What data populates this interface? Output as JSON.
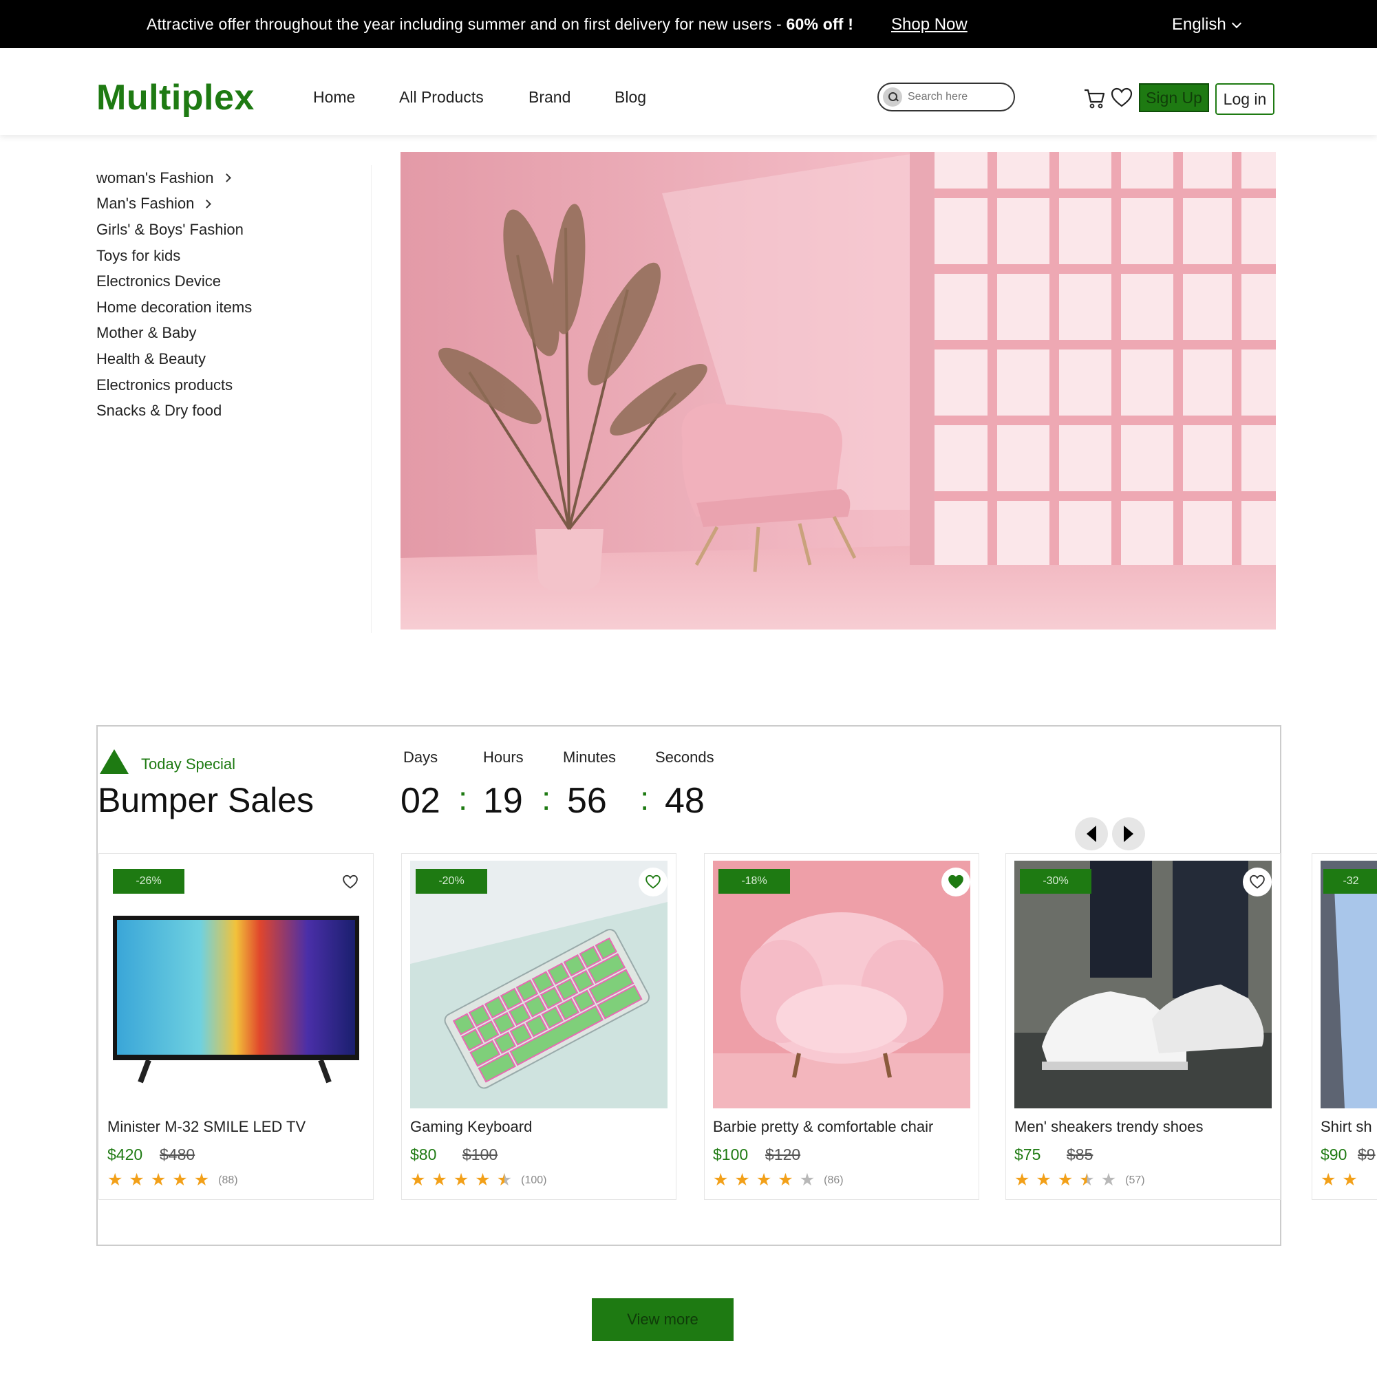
{
  "topbar": {
    "promo_text": "Attractive offer throughout the year including summer and on first delivery for new users - ",
    "promo_bold": "60% off !",
    "shop_now": "Shop Now",
    "language": "English"
  },
  "header": {
    "logo": "Multiplex",
    "nav": [
      "Home",
      "All Products",
      "Brand",
      "Blog"
    ],
    "search_placeholder": "Search here",
    "signup": "Sign Up",
    "login": "Log in"
  },
  "sidebar": {
    "categories": [
      {
        "label": "woman's Fashion"
      },
      {
        "label": "Man's Fashion"
      },
      {
        "label": "Girls' & Boys' Fashion"
      },
      {
        "label": "Toys for kids"
      },
      {
        "label": "Electronics Device"
      },
      {
        "label": "Home decoration items"
      },
      {
        "label": "Mother & Baby"
      },
      {
        "label": "Health & Beauty"
      },
      {
        "label": "Electronics products"
      },
      {
        "label": "Snacks & Dry food"
      }
    ]
  },
  "flash": {
    "tag": "Today Special",
    "title": "Bumper Sales",
    "countdown": {
      "labels": [
        "Days",
        "Hours",
        "Minutes",
        "Seconds"
      ],
      "values": [
        "02",
        "19",
        "56",
        "48"
      ],
      "separator": ":"
    }
  },
  "products": [
    {
      "badge": "-26%",
      "name": "Minister M-32 SMILE  LED TV",
      "price": "$420",
      "old_price": "$480",
      "rating": 5,
      "reviews": "(88)",
      "wishlisted": false
    },
    {
      "badge": "-20%",
      "name": "Gaming Keyboard",
      "price": "$80",
      "old_price": "$100",
      "rating": 4.5,
      "reviews": "(100)",
      "wishlisted": false
    },
    {
      "badge": "-18%",
      "name": "Barbie pretty & comfortable chair",
      "price": "$100",
      "old_price": "$120",
      "rating": 4,
      "reviews": "(86)",
      "wishlisted": true
    },
    {
      "badge": "-30%",
      "name": "Men' sheakers trendy shoes",
      "price": "$75",
      "old_price": "$85",
      "rating": 3.5,
      "reviews": "(57)",
      "wishlisted": false
    },
    {
      "badge": "-32",
      "name": "Shirt sh",
      "price": "$90",
      "old_price": "$9",
      "rating": 2,
      "reviews": "",
      "wishlisted": false
    }
  ],
  "view_more": "View more",
  "colors": {
    "brand": "#1e7a12",
    "star": "#f2a019",
    "topbar": "#000000"
  }
}
